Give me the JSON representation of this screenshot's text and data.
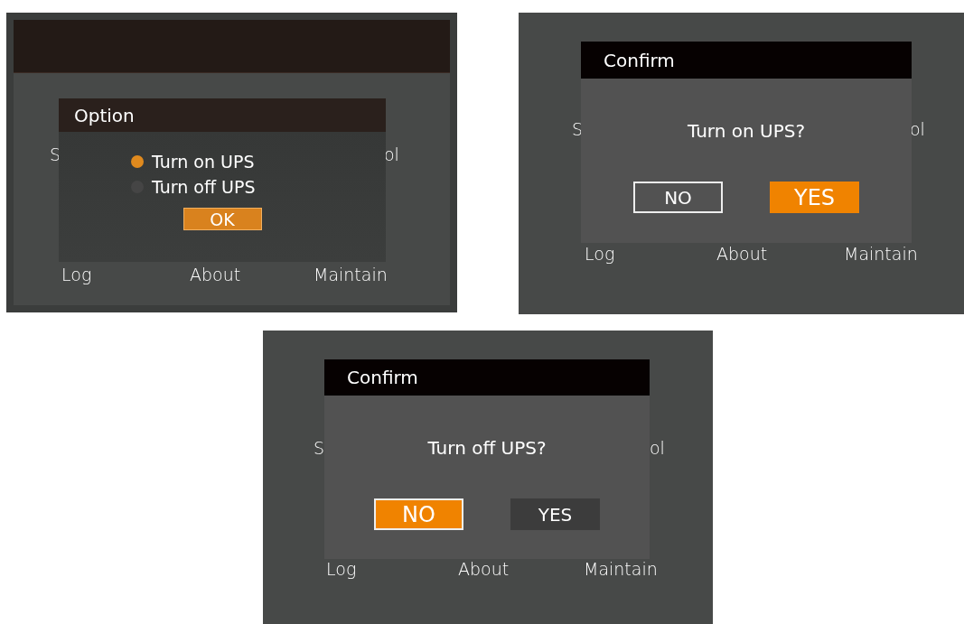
{
  "screens": [
    {
      "kind": "option",
      "top_bar": true,
      "side_labels": [
        "S",
        "ol"
      ],
      "menu": [
        "Log",
        "About",
        "Maintain"
      ],
      "dialog": {
        "title": "Option",
        "options": [
          {
            "label": "Turn on UPS",
            "selected": true
          },
          {
            "label": "Turn off UPS",
            "selected": false
          }
        ],
        "button": "OK"
      }
    },
    {
      "kind": "confirm",
      "top_bar": false,
      "side_labels": [
        "S",
        "ol"
      ],
      "menu": [
        "Log",
        "About",
        "Maintain"
      ],
      "dialog": {
        "title": "Confirm",
        "message": "Turn on UPS?",
        "buttons": [
          {
            "label": "NO",
            "selected": false,
            "outlined": true
          },
          {
            "label": "YES",
            "selected": true,
            "outlined": false
          }
        ]
      }
    },
    {
      "kind": "confirm",
      "top_bar": false,
      "side_labels": [
        "S",
        "ol"
      ],
      "menu": [
        "Log",
        "About",
        "Maintain"
      ],
      "dialog": {
        "title": "Confirm",
        "message": "Turn off UPS?",
        "buttons": [
          {
            "label": "NO",
            "selected": true,
            "outlined": true
          },
          {
            "label": "YES",
            "selected": false,
            "outlined": false
          }
        ]
      }
    }
  ]
}
